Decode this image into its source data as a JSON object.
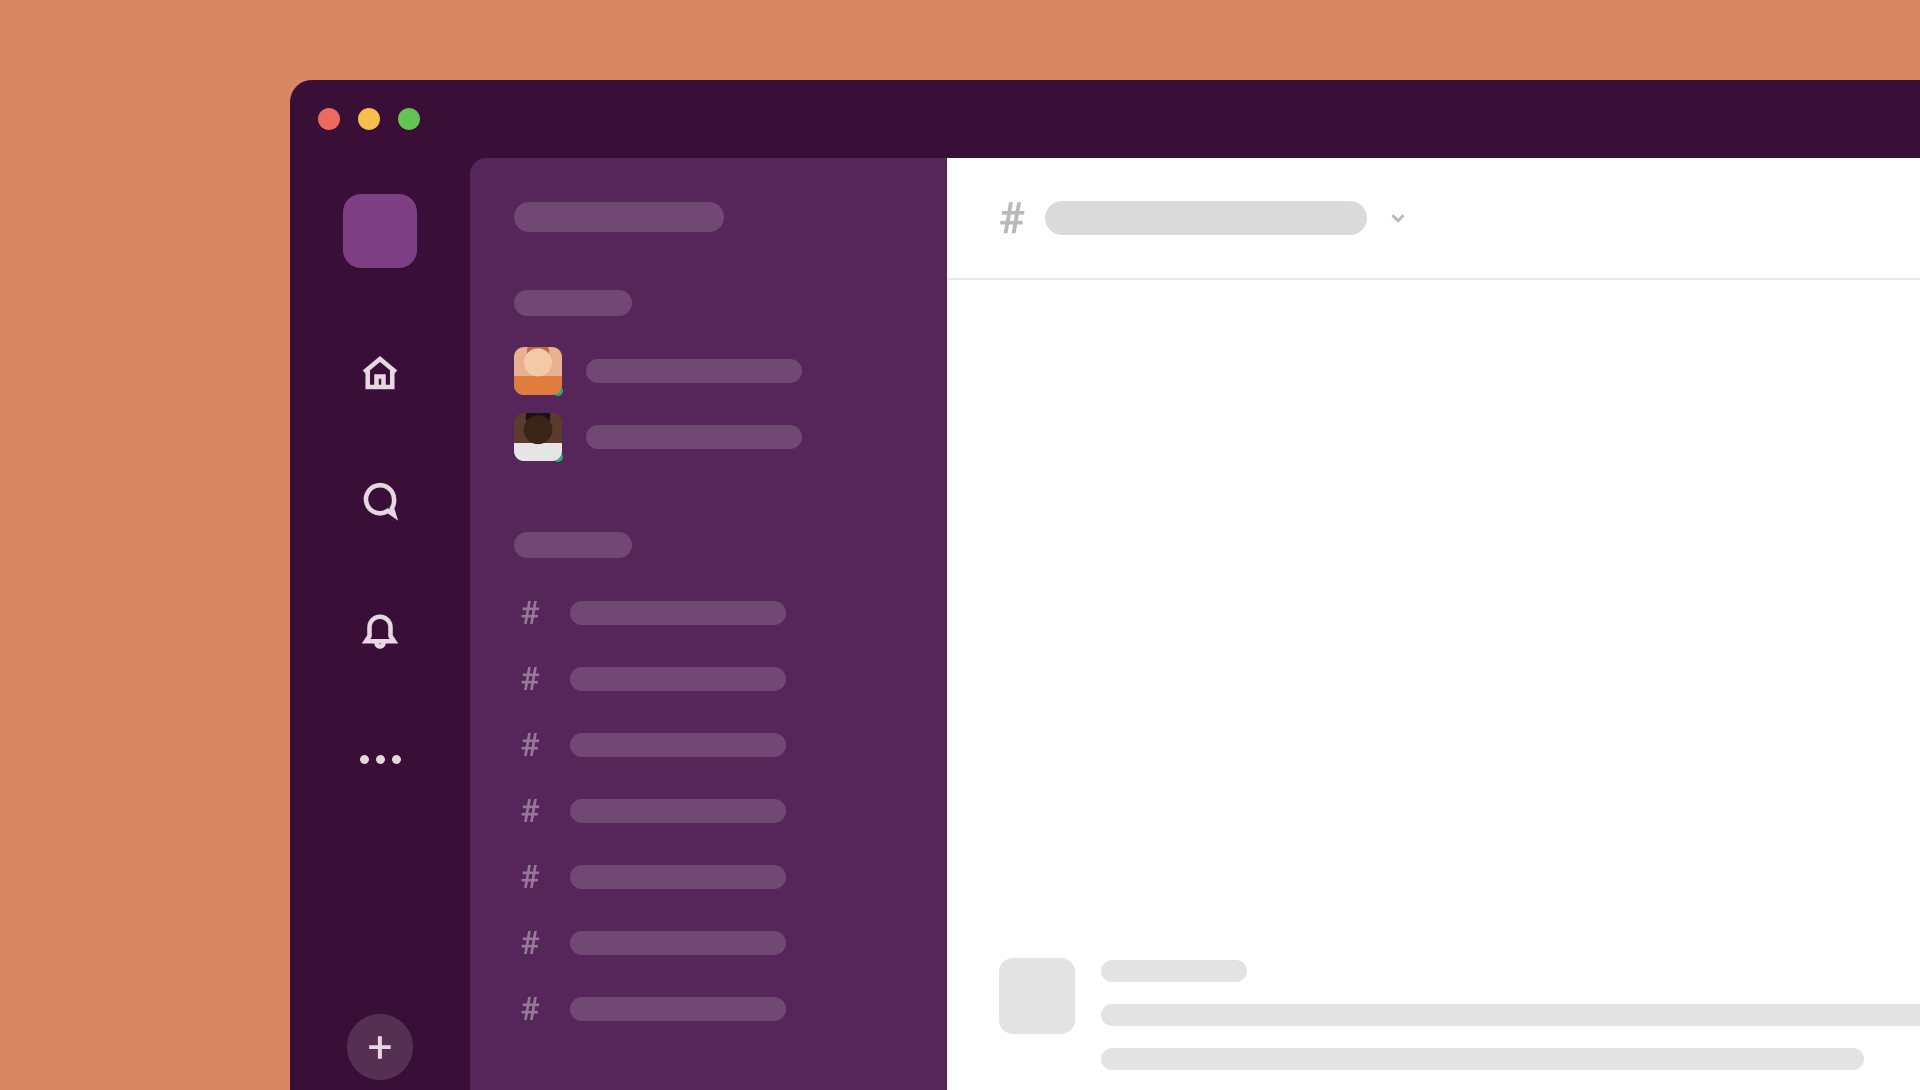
{
  "window": {
    "traffic_lights": [
      "close",
      "minimize",
      "maximize"
    ]
  },
  "nav_rail": {
    "workspace": "workspace-tile",
    "items": [
      {
        "name": "home",
        "icon": "home-icon"
      },
      {
        "name": "dms",
        "icon": "chat-icon"
      },
      {
        "name": "activity",
        "icon": "bell-icon"
      },
      {
        "name": "more",
        "icon": "more-icon"
      }
    ],
    "add_label": "+"
  },
  "sidebar": {
    "workspace_title_placeholder": "",
    "sections": [
      {
        "label_placeholder": "",
        "type": "dm",
        "items": [
          {
            "avatar": "av1",
            "online": true,
            "label_placeholder": ""
          },
          {
            "avatar": "av2",
            "online": true,
            "label_placeholder": ""
          }
        ]
      },
      {
        "label_placeholder": "",
        "type": "channels",
        "items": [
          {
            "prefix": "#",
            "label_placeholder": ""
          },
          {
            "prefix": "#",
            "label_placeholder": ""
          },
          {
            "prefix": "#",
            "label_placeholder": ""
          },
          {
            "prefix": "#",
            "label_placeholder": ""
          },
          {
            "prefix": "#",
            "label_placeholder": ""
          },
          {
            "prefix": "#",
            "label_placeholder": ""
          },
          {
            "prefix": "#",
            "label_placeholder": ""
          }
        ]
      }
    ]
  },
  "main": {
    "channel_prefix": "#",
    "channel_name_placeholder": "",
    "message_placeholder": {
      "avatar": "",
      "name_placeholder": "",
      "lines": [
        "",
        ""
      ]
    }
  }
}
